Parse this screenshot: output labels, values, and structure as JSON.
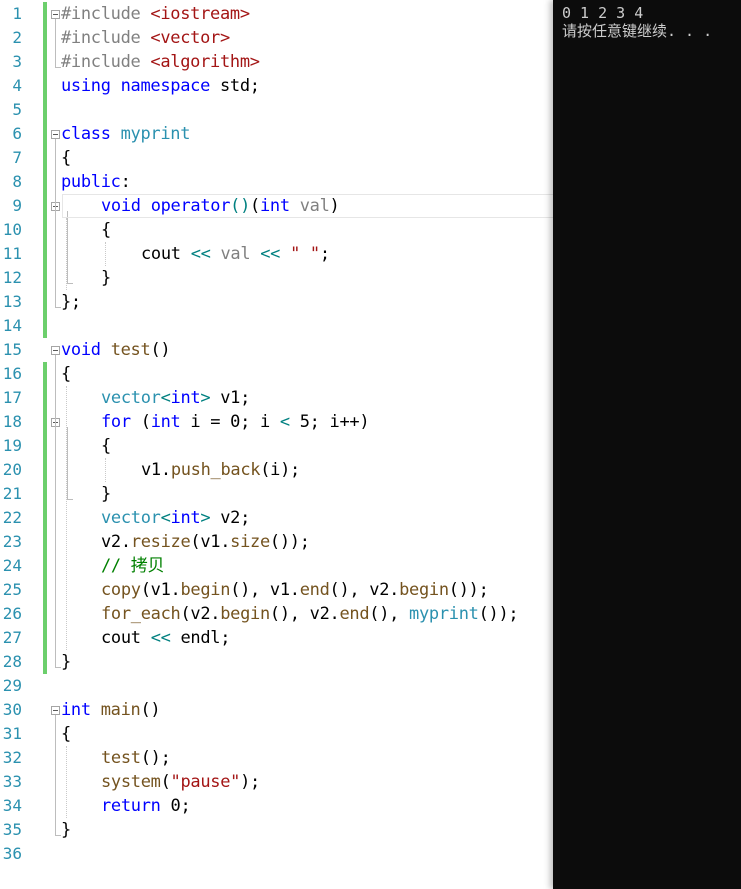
{
  "editor": {
    "line_numbers": [
      "1",
      "2",
      "3",
      "4",
      "5",
      "6",
      "7",
      "8",
      "9",
      "10",
      "11",
      "12",
      "13",
      "14",
      "15",
      "16",
      "17",
      "18",
      "19",
      "20",
      "21",
      "22",
      "23",
      "24",
      "25",
      "26",
      "27",
      "28",
      "29",
      "30",
      "31",
      "32",
      "33",
      "34",
      "35",
      "36"
    ],
    "lines": [
      {
        "n": 1,
        "indent": 0,
        "tokens": [
          {
            "t": "#include ",
            "c": "pp"
          },
          {
            "t": "<iostream>",
            "c": "inc"
          }
        ]
      },
      {
        "n": 2,
        "indent": 0,
        "tokens": [
          {
            "t": "#include ",
            "c": "pp"
          },
          {
            "t": "<vector>",
            "c": "inc"
          }
        ]
      },
      {
        "n": 3,
        "indent": 0,
        "tokens": [
          {
            "t": "#include ",
            "c": "pp"
          },
          {
            "t": "<algorithm>",
            "c": "inc"
          }
        ]
      },
      {
        "n": 4,
        "indent": 0,
        "tokens": [
          {
            "t": "using",
            "c": "kw"
          },
          {
            "t": " "
          },
          {
            "t": "namespace",
            "c": "kw"
          },
          {
            "t": " std;"
          }
        ]
      },
      {
        "n": 6,
        "indent": 0,
        "tokens": [
          {
            "t": "class",
            "c": "kw"
          },
          {
            "t": " "
          },
          {
            "t": "myprint",
            "c": "ty"
          }
        ]
      },
      {
        "n": 7,
        "indent": 0,
        "tokens": [
          {
            "t": "{"
          }
        ]
      },
      {
        "n": 8,
        "indent": 0,
        "tokens": [
          {
            "t": "public",
            "c": "kw"
          },
          {
            "t": ":"
          }
        ]
      },
      {
        "n": 9,
        "indent": 1,
        "tokens": [
          {
            "t": "void",
            "c": "kw"
          },
          {
            "t": " "
          },
          {
            "t": "operator",
            "c": "kw"
          },
          {
            "t": "()",
            "c": "op"
          },
          {
            "t": "("
          },
          {
            "t": "int",
            "c": "kw"
          },
          {
            "t": " "
          },
          {
            "t": "val",
            "c": "pa"
          },
          {
            "t": ")"
          }
        ]
      },
      {
        "n": 10,
        "indent": 1,
        "tokens": [
          {
            "t": "{"
          }
        ]
      },
      {
        "n": 11,
        "indent": 2,
        "tokens": [
          {
            "t": "cout "
          },
          {
            "t": "<<",
            "c": "op"
          },
          {
            "t": " "
          },
          {
            "t": "val",
            "c": "pa"
          },
          {
            "t": " "
          },
          {
            "t": "<<",
            "c": "op"
          },
          {
            "t": " "
          },
          {
            "t": "\" \"",
            "c": "str"
          },
          {
            "t": ";"
          }
        ]
      },
      {
        "n": 12,
        "indent": 1,
        "tokens": [
          {
            "t": "}"
          }
        ]
      },
      {
        "n": 13,
        "indent": 0,
        "tokens": [
          {
            "t": "};"
          }
        ]
      },
      {
        "n": 15,
        "indent": 0,
        "tokens": [
          {
            "t": "void",
            "c": "kw"
          },
          {
            "t": " "
          },
          {
            "t": "test",
            "c": "fn"
          },
          {
            "t": "()"
          }
        ]
      },
      {
        "n": 16,
        "indent": 0,
        "tokens": [
          {
            "t": "{"
          }
        ]
      },
      {
        "n": 17,
        "indent": 1,
        "tokens": [
          {
            "t": "vector",
            "c": "ty"
          },
          {
            "t": "<",
            "c": "op"
          },
          {
            "t": "int",
            "c": "kw"
          },
          {
            "t": ">",
            "c": "op"
          },
          {
            "t": " v1;"
          }
        ]
      },
      {
        "n": 18,
        "indent": 1,
        "tokens": [
          {
            "t": "for",
            "c": "kw"
          },
          {
            "t": " ("
          },
          {
            "t": "int",
            "c": "kw"
          },
          {
            "t": " i = 0; i "
          },
          {
            "t": "<",
            "c": "op"
          },
          {
            "t": " 5; i++)"
          }
        ]
      },
      {
        "n": 19,
        "indent": 1,
        "tokens": [
          {
            "t": "{"
          }
        ]
      },
      {
        "n": 20,
        "indent": 2,
        "tokens": [
          {
            "t": "v1."
          },
          {
            "t": "push_back",
            "c": "fn"
          },
          {
            "t": "(i);"
          }
        ]
      },
      {
        "n": 21,
        "indent": 1,
        "tokens": [
          {
            "t": "}"
          }
        ]
      },
      {
        "n": 22,
        "indent": 1,
        "tokens": [
          {
            "t": "vector",
            "c": "ty"
          },
          {
            "t": "<",
            "c": "op"
          },
          {
            "t": "int",
            "c": "kw"
          },
          {
            "t": ">",
            "c": "op"
          },
          {
            "t": " v2;"
          }
        ]
      },
      {
        "n": 23,
        "indent": 1,
        "tokens": [
          {
            "t": "v2."
          },
          {
            "t": "resize",
            "c": "fn"
          },
          {
            "t": "(v1."
          },
          {
            "t": "size",
            "c": "fn"
          },
          {
            "t": "());"
          }
        ]
      },
      {
        "n": 24,
        "indent": 1,
        "tokens": [
          {
            "t": "// 拷贝",
            "c": "cm"
          }
        ]
      },
      {
        "n": 25,
        "indent": 1,
        "tokens": [
          {
            "t": "copy",
            "c": "fn"
          },
          {
            "t": "(v1."
          },
          {
            "t": "begin",
            "c": "fn"
          },
          {
            "t": "(), v1."
          },
          {
            "t": "end",
            "c": "fn"
          },
          {
            "t": "(), v2."
          },
          {
            "t": "begin",
            "c": "fn"
          },
          {
            "t": "());"
          }
        ]
      },
      {
        "n": 26,
        "indent": 1,
        "tokens": [
          {
            "t": "for_each",
            "c": "fn"
          },
          {
            "t": "(v2."
          },
          {
            "t": "begin",
            "c": "fn"
          },
          {
            "t": "(), v2."
          },
          {
            "t": "end",
            "c": "fn"
          },
          {
            "t": "(), "
          },
          {
            "t": "myprint",
            "c": "ty"
          },
          {
            "t": "());"
          }
        ]
      },
      {
        "n": 27,
        "indent": 1,
        "tokens": [
          {
            "t": "cout "
          },
          {
            "t": "<<",
            "c": "op"
          },
          {
            "t": " endl;"
          }
        ]
      },
      {
        "n": 28,
        "indent": 0,
        "tokens": [
          {
            "t": "}"
          }
        ]
      },
      {
        "n": 30,
        "indent": 0,
        "tokens": [
          {
            "t": "int",
            "c": "kw"
          },
          {
            "t": " "
          },
          {
            "t": "main",
            "c": "fn"
          },
          {
            "t": "()"
          }
        ]
      },
      {
        "n": 31,
        "indent": 0,
        "tokens": [
          {
            "t": "{"
          }
        ]
      },
      {
        "n": 32,
        "indent": 1,
        "tokens": [
          {
            "t": "test",
            "c": "fn"
          },
          {
            "t": "();"
          }
        ]
      },
      {
        "n": 33,
        "indent": 1,
        "tokens": [
          {
            "t": "system",
            "c": "fn"
          },
          {
            "t": "("
          },
          {
            "t": "\"pause\"",
            "c": "str"
          },
          {
            "t": ");"
          }
        ]
      },
      {
        "n": 34,
        "indent": 1,
        "tokens": [
          {
            "t": "return",
            "c": "kw"
          },
          {
            "t": " 0;"
          }
        ]
      },
      {
        "n": 35,
        "indent": 0,
        "tokens": [
          {
            "t": "}"
          }
        ]
      }
    ]
  },
  "console": {
    "output": "0 1 2 3 4",
    "prompt": "请按任意键继续. . ."
  },
  "colors": {
    "keyword": "#0000ff",
    "type": "#2b91af",
    "string": "#a31515",
    "comment": "#008000",
    "operator": "#008080",
    "console_bg": "#0c0c0c",
    "change_bar": "#6ccf6c"
  }
}
